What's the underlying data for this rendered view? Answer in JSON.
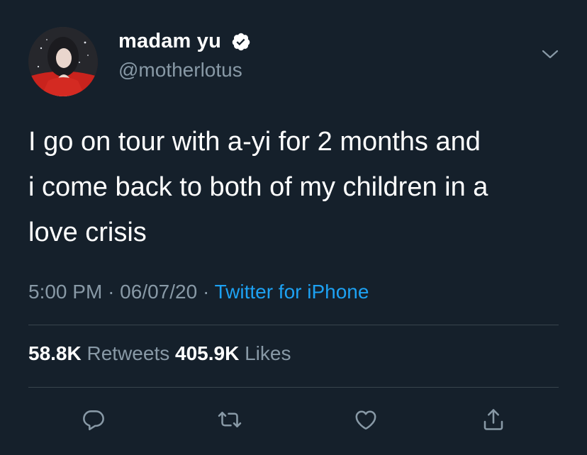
{
  "user": {
    "display_name": "madam yu",
    "handle": "@motherlotus",
    "verified": true
  },
  "tweet": {
    "lines": [
      "I go on tour with a-yi for 2 months and",
      "i come back to both of my children in a",
      "love crisis"
    ],
    "time": "5:00 PM",
    "date": "06/07/20",
    "separator": "·",
    "source": "Twitter for iPhone"
  },
  "stats": {
    "retweets_count": "58.8K",
    "retweets_label": "Retweets",
    "likes_count": "405.9K",
    "likes_label": "Likes"
  },
  "actions": [
    "reply-icon",
    "retweet-icon",
    "like-icon",
    "share-icon"
  ],
  "colors": {
    "background": "#15202b",
    "text": "#ffffff",
    "secondary": "#8899a6",
    "accent": "#1da1f2",
    "divider": "#38444d"
  }
}
